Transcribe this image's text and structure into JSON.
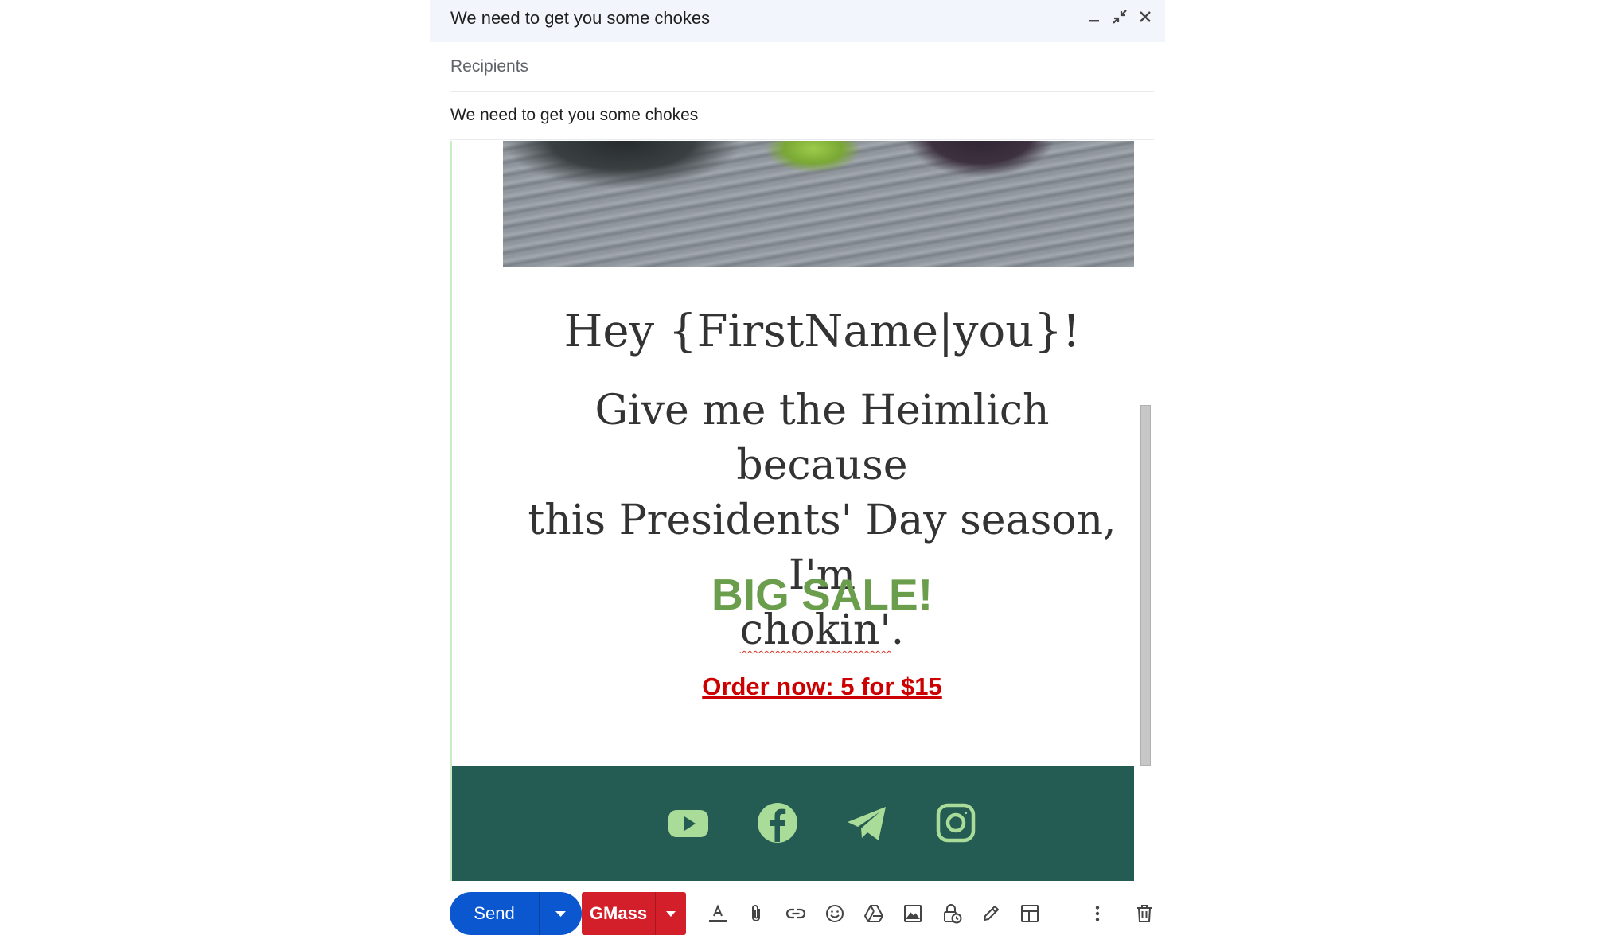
{
  "window": {
    "title": "We need to get you some chokes"
  },
  "fields": {
    "recipients_placeholder": "Recipients",
    "subject_value": "We need to get you some chokes"
  },
  "email": {
    "greeting": "Hey {FirstName|you}!",
    "headline_line1": "Give me the Heimlich because",
    "headline_line2": "this Presidents' Day season, I'm",
    "headline_word": "chokin'",
    "headline_end": ".",
    "sale": "BIG SALE!",
    "order_link": "Order now: 5 for $15",
    "social": [
      "youtube-icon",
      "facebook-icon",
      "telegram-icon",
      "instagram-icon"
    ]
  },
  "toolbar": {
    "send_label": "Send",
    "gmass_label": "GMass",
    "tools": [
      "formatting-icon",
      "attach-icon",
      "link-icon",
      "emoji-icon",
      "drive-icon",
      "photo-icon",
      "confidential-icon",
      "signature-icon",
      "layout-icon",
      "more-options-icon",
      "discard-icon"
    ]
  },
  "colors": {
    "send_blue": "#0b57d0",
    "gmass_red": "#d21f2a",
    "sale_green": "#6a9e4c",
    "order_red": "#cc0000",
    "footer_teal": "#245b52",
    "social_icon": "#a9dc98"
  }
}
